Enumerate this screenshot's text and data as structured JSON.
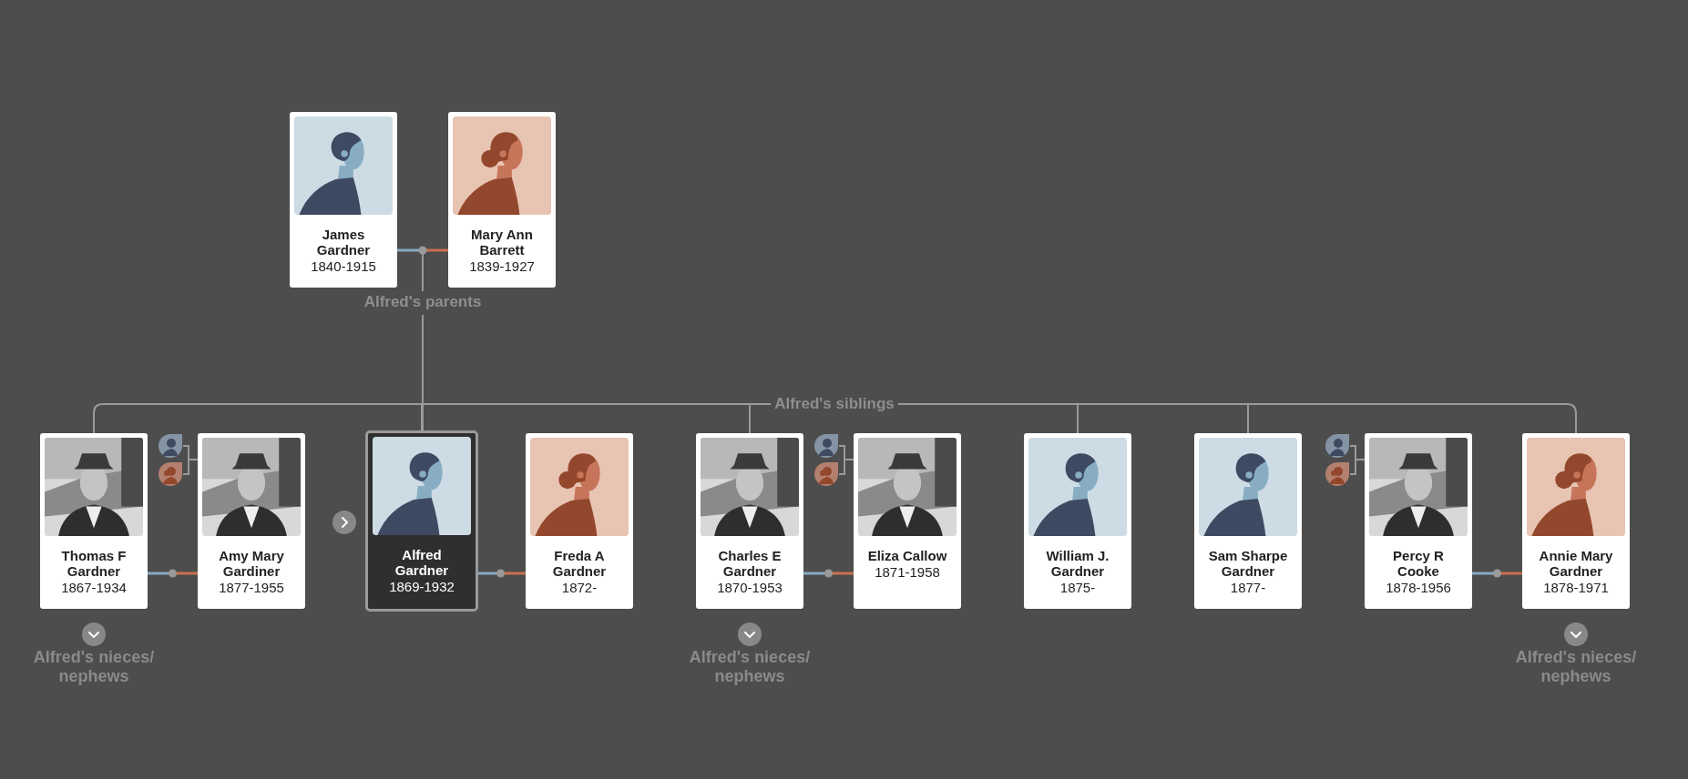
{
  "parents": {
    "label": "Alfred's parents",
    "people": [
      {
        "name": "James Gardner",
        "dates": "1840-1915",
        "kind": "avatar_male",
        "selected": false
      },
      {
        "name": "Mary Ann Barrett",
        "dates": "1839-1927",
        "kind": "avatar_female",
        "selected": false
      }
    ]
  },
  "siblings": {
    "label": "Alfred's siblings",
    "families": [
      {
        "members": [
          {
            "name": "Thomas F Gardner",
            "dates": "1867-1934",
            "kind": "picture",
            "selected": false,
            "sibling": true
          },
          {
            "name": "Amy Mary Gardiner",
            "dates": "1877-1955",
            "kind": "picture",
            "selected": false,
            "sibling": false
          }
        ],
        "spouse_switcher": true,
        "nav_arrow": false,
        "expand_label": "Alfred's nieces/ nephews"
      },
      {
        "members": [
          {
            "name": "Alfred Gardner",
            "dates": "1869-1932",
            "kind": "avatar_male",
            "selected": true,
            "sibling": true
          },
          {
            "name": "Freda A Gardner",
            "dates": "1872-",
            "kind": "avatar_female",
            "selected": false,
            "sibling": false
          }
        ],
        "spouse_switcher": false,
        "nav_arrow": true
      },
      {
        "members": [
          {
            "name": "Charles E Gardner",
            "dates": "1870-1953",
            "kind": "picture",
            "selected": false,
            "sibling": true
          },
          {
            "name": "Eliza Callow",
            "dates": "1871-1958",
            "kind": "picture",
            "selected": false,
            "sibling": false
          }
        ],
        "spouse_switcher": true,
        "nav_arrow": false,
        "expand_label": "Alfred's nieces/ nephews"
      },
      {
        "members": [
          {
            "name": "William J. Gardner",
            "dates": "1875-",
            "kind": "avatar_male",
            "selected": false,
            "sibling": true
          }
        ],
        "spouse_switcher": false,
        "nav_arrow": false
      },
      {
        "members": [
          {
            "name": "Sam Sharpe Gardner",
            "dates": "1877-",
            "kind": "avatar_male",
            "selected": false,
            "sibling": true
          }
        ],
        "spouse_switcher": false,
        "nav_arrow": false
      },
      {
        "members": [
          {
            "name": "Percy R Cooke",
            "dates": "1878-1956",
            "kind": "picture",
            "selected": false,
            "sibling": false
          },
          {
            "name": "Annie Mary Gardner",
            "dates": "1878-1971",
            "kind": "avatar_female",
            "selected": false,
            "sibling": true
          }
        ],
        "spouse_switcher": true,
        "nav_arrow": false,
        "expand_label": "Alfred's nieces/ nephews"
      }
    ]
  }
}
